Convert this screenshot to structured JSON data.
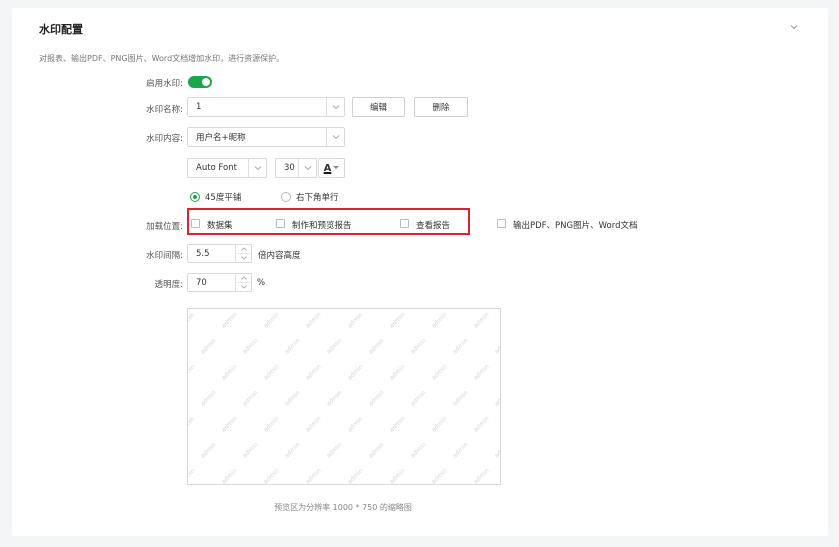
{
  "section": {
    "title": "水印配置",
    "description": "对报表、输出PDF、PNG图片、Word文档增加水印，进行资源保护。"
  },
  "enable": {
    "label": "启用水印:",
    "on": true
  },
  "name": {
    "label": "水印名称:",
    "value": "1",
    "edit_button": "编辑",
    "delete_button": "删除"
  },
  "content": {
    "label": "水印内容:",
    "value": "用户名+昵称",
    "font": "Auto Font",
    "font_size": "30",
    "font_color_glyph": "A"
  },
  "layout": {
    "options": [
      {
        "label": "45度平铺",
        "selected": true
      },
      {
        "label": "右下角单行",
        "selected": false
      }
    ]
  },
  "load_position": {
    "label": "加载位置:",
    "options": [
      {
        "label": "数据集",
        "checked": false
      },
      {
        "label": "制作和预览报告",
        "checked": false
      },
      {
        "label": "查看报告",
        "checked": false
      },
      {
        "label": "输出PDF、PNG图片、Word文档",
        "checked": false
      }
    ]
  },
  "spacing": {
    "label": "水印间隔:",
    "value": "5.5",
    "suffix": "倍内容高度"
  },
  "opacity": {
    "label": "透明度:",
    "value": "70",
    "suffix": "%"
  },
  "preview": {
    "watermark_text": "admin",
    "caption": "预览区为分辨率 1000 * 750 的缩略图"
  },
  "colors": {
    "accent": "#1aa74b",
    "highlight_border": "#d9242b"
  }
}
